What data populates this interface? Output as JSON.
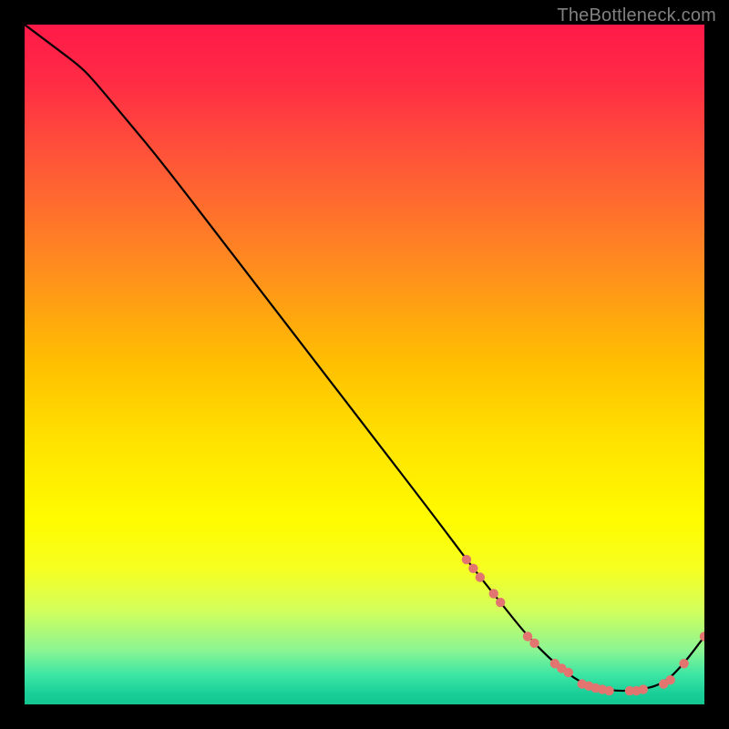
{
  "watermark": "TheBottleneck.com",
  "colors": {
    "background": "#000000",
    "gradient_stops": [
      {
        "offset": 0.0,
        "color": "#ff1a48"
      },
      {
        "offset": 0.08,
        "color": "#ff2a45"
      },
      {
        "offset": 0.2,
        "color": "#ff5638"
      },
      {
        "offset": 0.35,
        "color": "#ff8a20"
      },
      {
        "offset": 0.5,
        "color": "#ffc000"
      },
      {
        "offset": 0.62,
        "color": "#ffe400"
      },
      {
        "offset": 0.73,
        "color": "#fffc00"
      },
      {
        "offset": 0.8,
        "color": "#f6ff20"
      },
      {
        "offset": 0.86,
        "color": "#d4ff5a"
      },
      {
        "offset": 0.92,
        "color": "#8cf592"
      },
      {
        "offset": 0.955,
        "color": "#3fe6a4"
      },
      {
        "offset": 0.985,
        "color": "#18cf98"
      },
      {
        "offset": 1.0,
        "color": "#14c590"
      }
    ],
    "curve": "#000000",
    "marker": "#e2756f"
  },
  "chart_data": {
    "type": "line",
    "title": "",
    "xlabel": "",
    "ylabel": "",
    "xlim": [
      0,
      100
    ],
    "ylim": [
      0,
      100
    ],
    "grid": false,
    "legend": false,
    "series": [
      {
        "name": "bottleneck-curve",
        "x": [
          0,
          4,
          8,
          10,
          15,
          20,
          30,
          40,
          50,
          60,
          66,
          70,
          74,
          78,
          82,
          86,
          90,
          94,
          97,
          100
        ],
        "y": [
          100,
          97,
          94,
          92,
          86,
          80,
          67,
          54,
          41,
          28,
          20,
          15,
          10,
          6,
          3,
          2,
          2,
          3,
          6,
          10
        ]
      }
    ],
    "markers": {
      "name": "highlighted-points",
      "x": [
        65,
        66,
        67,
        69,
        70,
        74,
        75,
        78,
        79,
        80,
        82,
        83,
        84,
        85,
        86,
        89,
        90,
        91,
        94,
        95,
        97,
        100
      ],
      "y": [
        21.3,
        20.0,
        18.7,
        16.3,
        15.0,
        10.0,
        9.0,
        6.0,
        5.3,
        4.7,
        3.0,
        2.7,
        2.4,
        2.2,
        2.0,
        2.0,
        2.0,
        2.2,
        3.0,
        3.6,
        6.0,
        10.0
      ]
    }
  }
}
